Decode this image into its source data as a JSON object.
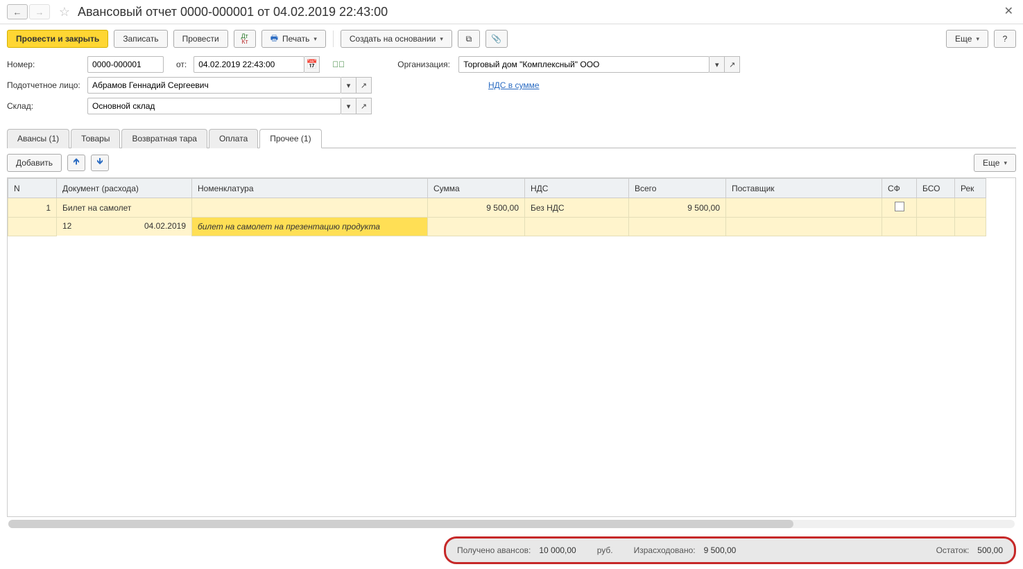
{
  "title": "Авансовый отчет 0000-000001 от 04.02.2019 22:43:00",
  "toolbar": {
    "post_close": "Провести и закрыть",
    "save": "Записать",
    "post": "Провести",
    "print": "Печать",
    "create_based": "Создать на основании",
    "more": "Еще",
    "help": "?"
  },
  "form": {
    "number_label": "Номер:",
    "number_value": "0000-000001",
    "ot_label": "от:",
    "date_value": "04.02.2019 22:43:00",
    "org_label": "Организация:",
    "org_value": "Торговый дом \"Комплексный\" ООО",
    "person_label": "Подотчетное лицо:",
    "person_value": "Абрамов Геннадий Сергеевич",
    "vat_link": "НДС в сумме",
    "warehouse_label": "Склад:",
    "warehouse_value": "Основной склад"
  },
  "tabs": {
    "t0": "Авансы (1)",
    "t1": "Товары",
    "t2": "Возвратная тара",
    "t3": "Оплата",
    "t4": "Прочее (1)"
  },
  "subbar": {
    "add": "Добавить",
    "more": "Еще"
  },
  "grid": {
    "h_n": "N",
    "h_doc": "Документ (расхода)",
    "h_nom": "Номенклатура",
    "h_sum": "Сумма",
    "h_vat": "НДС",
    "h_total": "Всего",
    "h_supplier": "Поставщик",
    "h_sf": "СФ",
    "h_bso": "БСО",
    "h_rek": "Рек",
    "r1_n": "1",
    "r1_doc": "Билет на самолет",
    "r1_sum": "9 500,00",
    "r1_vat": "Без НДС",
    "r1_total": "9 500,00",
    "r2_num": "12",
    "r2_date": "04.02.2019",
    "r2_nom": "билет на самолет на презентацию продукта"
  },
  "footer": {
    "received_label": "Получено авансов:",
    "received_value": "10 000,00",
    "currency": "руб.",
    "spent_label": "Израсходовано:",
    "spent_value": "9 500,00",
    "remain_label": "Остаток:",
    "remain_value": "500,00"
  }
}
